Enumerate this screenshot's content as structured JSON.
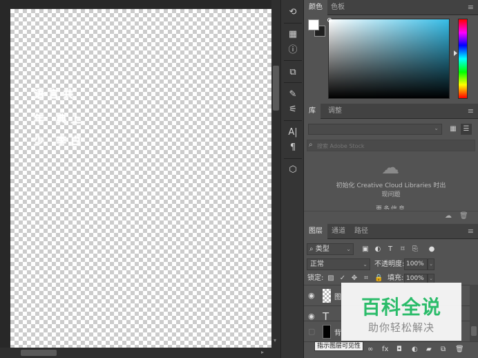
{
  "canvas": {
    "text_lines": [
      "语言共",
      "年 典上",
      "少 李白"
    ]
  },
  "toolstrip": {
    "icons": [
      "history-icon",
      "properties-icon",
      "info-icon",
      "swatches-icon",
      "brush-icon",
      "brush-settings-icon",
      "character-icon",
      "paragraph-icon",
      "3d-icon"
    ]
  },
  "color_panel": {
    "tabs": [
      "颜色",
      "色板"
    ],
    "foreground": "#ffffff",
    "background": "#202020",
    "hue_color": "#36bde8",
    "menu_icon": "≡"
  },
  "library_panel": {
    "tabs": [
      "库",
      "调整"
    ],
    "search_placeholder": "搜索 Adobe Stock",
    "message": "初始化 Creative Cloud Libraries 时出现问题",
    "more_text": "更多信息"
  },
  "layers_panel": {
    "tabs": [
      "图层",
      "通道",
      "路径"
    ],
    "kind_label": "类型",
    "blend_mode": "正常",
    "opacity_label": "不透明度:",
    "opacity_value": "100%",
    "lock_label": "锁定:",
    "fill_label": "填充:",
    "fill_value": "100%",
    "layers": [
      {
        "name": "图",
        "type": "smart"
      },
      {
        "name": "",
        "type": "text"
      },
      {
        "name": "背",
        "type": "background"
      }
    ],
    "tooltip": "指示图层可见性"
  },
  "watermark": {
    "title": "百科全说",
    "subtitle": "助你轻松解决"
  }
}
